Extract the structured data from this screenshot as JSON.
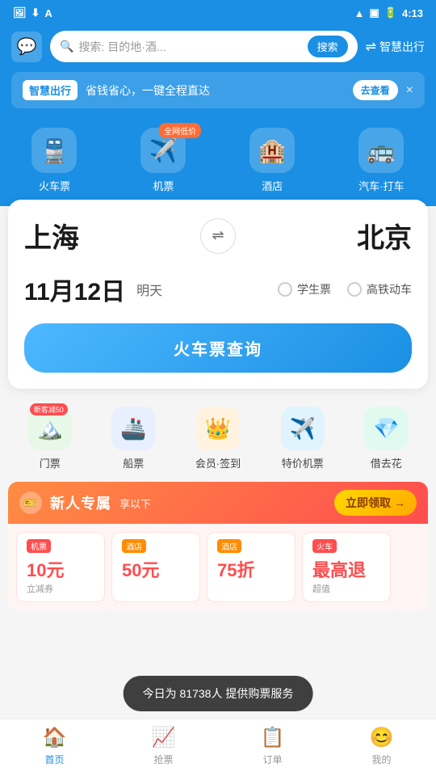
{
  "statusBar": {
    "time": "4:13",
    "icons": [
      "wifi",
      "signal",
      "battery"
    ]
  },
  "header": {
    "chatIcon": "💬",
    "searchPlaceholder": "搜索: 目的地·酒...",
    "searchBtn": "搜索",
    "rightIcon": "⇌",
    "rightLabel": "智慧出行"
  },
  "banner": {
    "tag": "智慧出行",
    "text": "省钱省心，一键全程直达",
    "btnLabel": "去查看",
    "closeIcon": "×"
  },
  "navIcons": [
    {
      "id": "train",
      "icon": "🚆",
      "label": "火车票",
      "badge": null
    },
    {
      "id": "flight",
      "icon": "✈️",
      "label": "机票",
      "badge": "全网低价"
    },
    {
      "id": "hotel",
      "icon": "🏨",
      "label": "酒店",
      "badge": null
    },
    {
      "id": "bus",
      "icon": "🚌",
      "label": "汽车·打车",
      "badge": null
    }
  ],
  "mainCard": {
    "fromCity": "上海",
    "toCity": "北京",
    "swapIcon": "⇌",
    "date": "11月12日",
    "dateSub": "明天",
    "options": [
      {
        "label": "学生票"
      },
      {
        "label": "高铁动车"
      }
    ],
    "searchBtnLabel": "火车票查询"
  },
  "quickAccess": [
    {
      "id": "scenic",
      "icon": "🏔️",
      "label": "门票",
      "color": "green",
      "badge": "新客减50"
    },
    {
      "id": "ferry",
      "icon": "🚢",
      "label": "船票",
      "color": "blue",
      "badge": null
    },
    {
      "id": "member",
      "icon": "👑",
      "label": "会员·签到",
      "color": "orange",
      "badge": null
    },
    {
      "id": "discount-flight",
      "icon": "✈️",
      "label": "特价机票",
      "color": "sky",
      "badge": null
    },
    {
      "id": "loan",
      "icon": "💎",
      "label": "借去花",
      "color": "teal",
      "badge": null
    }
  ],
  "promo": {
    "logo": "🎫",
    "title": "新人专属",
    "subtitle": "享以下",
    "ctaLabel": "立即领取",
    "ctaArrow": "→",
    "cards": [
      {
        "tag": "机票",
        "tagColor": "red",
        "amount": "10元",
        "desc": "立减券"
      },
      {
        "tag": "酒店",
        "tagColor": "hotel",
        "amount": "50元",
        "desc": ""
      },
      {
        "tag": "酒店",
        "tagColor": "hotel",
        "amount": "75折",
        "desc": ""
      },
      {
        "tag": "火车",
        "tagColor": "red",
        "amount": "最高退",
        "desc": "超值"
      }
    ]
  },
  "toast": {
    "text": "今日为 81738人 提供购票服务"
  },
  "bottomNav": [
    {
      "id": "home",
      "icon": "🏠",
      "label": "首页",
      "active": true
    },
    {
      "id": "grab",
      "icon": "📈",
      "label": "抢票",
      "active": false
    },
    {
      "id": "orders",
      "icon": "📋",
      "label": "订单",
      "active": false
    },
    {
      "id": "profile",
      "icon": "😊",
      "label": "我的",
      "active": false
    }
  ]
}
